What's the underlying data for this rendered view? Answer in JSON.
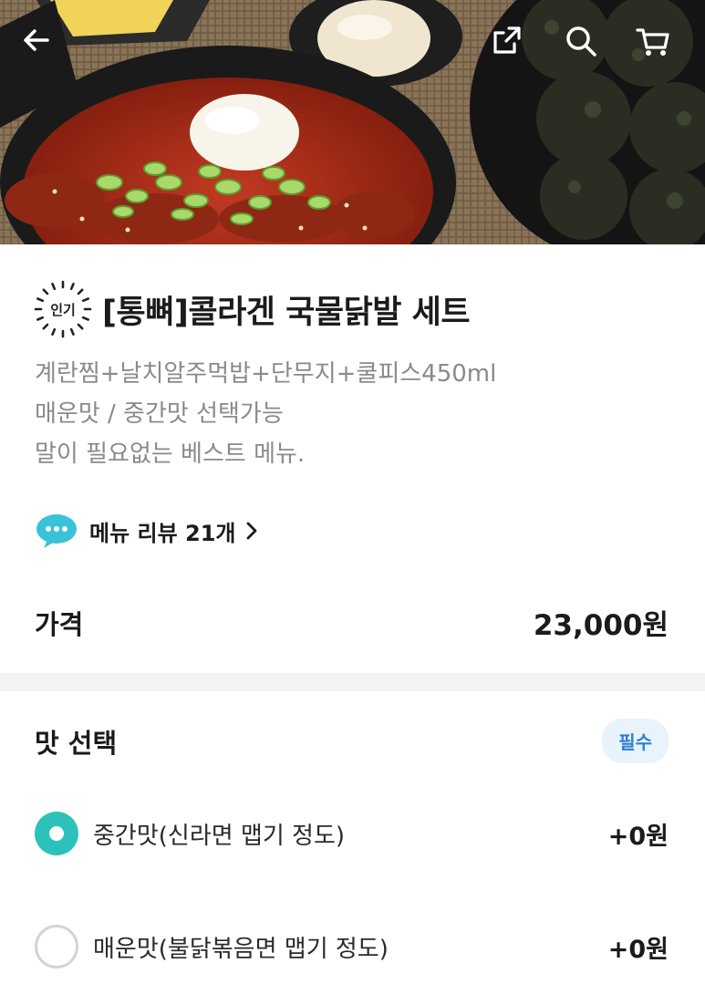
{
  "colors": {
    "accent": "#2cc1bb",
    "required_badge_bg": "#e8f3fc",
    "required_badge_text": "#2f7fd1",
    "description_text": "#8a8a8a",
    "divider": "#f1f3f5"
  },
  "header": {
    "back_icon": "back-arrow-icon",
    "share_icon": "share-icon",
    "search_icon": "search-icon",
    "cart_icon": "cart-icon"
  },
  "product": {
    "badge_text": "인기",
    "title": "[통뼈]콜라겐 국물닭발 세트",
    "description_lines": [
      "계란찜+날치알주먹밥+단무지+쿨피스450ml",
      "매운맛 / 중간맛 선택가능",
      "말이 필요없는 베스트 메뉴."
    ],
    "review_label": "메뉴 리뷰 21개",
    "price_label": "가격",
    "price_value": "23,000원"
  },
  "options_section": {
    "title": "맛 선택",
    "required_label": "필수",
    "options": [
      {
        "label": "중간맛(신라면 맵기 정도)",
        "price": "+0원",
        "selected": true
      },
      {
        "label": "매운맛(불닭볶음면 맵기 정도)",
        "price": "+0원",
        "selected": false
      }
    ]
  }
}
